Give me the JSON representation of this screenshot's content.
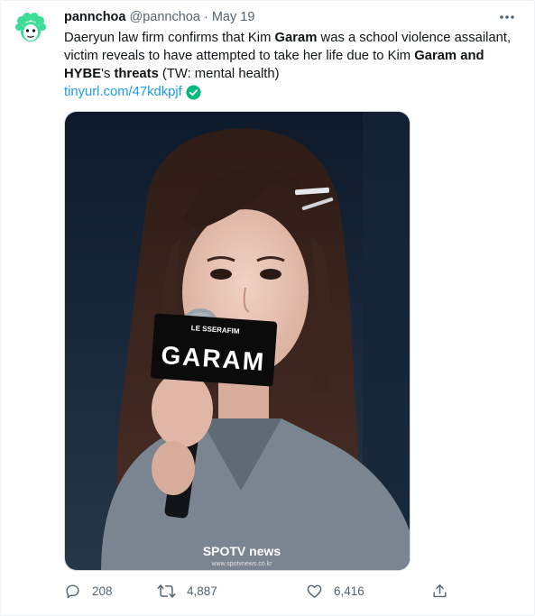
{
  "tweet": {
    "display_name": "pannchoa",
    "handle": "@pannchoa",
    "separator": "·",
    "date": "May 19",
    "text": {
      "seg1": "Daeryun law firm confirms that Kim ",
      "seg2": "Garam",
      "seg3": " was a school violence assailant, victim reveals to have attempted to take her life due to Kim ",
      "seg4": "Garam",
      "seg5": " ",
      "seg6": "and",
      "seg7": " ",
      "seg8": "HYBE",
      "seg9": "'s ",
      "seg10": "threats",
      "seg11": " (TW: mental health)"
    },
    "link": "tinyurl.com/47kdkpjf",
    "media": {
      "sign_small": "LE SSERAFIM",
      "sign_big": "GARAM",
      "watermark_brand": "SPOTV news",
      "watermark_url": "www.spotvnews.co.kr"
    },
    "actions": {
      "replies": "208",
      "retweets": "4,887",
      "likes": "6,416"
    }
  },
  "colors": {
    "accent": "#1d9bf0",
    "verified": "#00ba7c",
    "avatar_green": "#3ddc97",
    "muted": "#536471"
  },
  "icons": {
    "avatar": "sheep-avatar-icon",
    "more": "more-dots-icon",
    "verified": "checkmark-badge-icon",
    "reply": "reply-bubble-icon",
    "retweet": "retweet-icon",
    "like": "heart-icon",
    "share": "share-upload-icon"
  }
}
